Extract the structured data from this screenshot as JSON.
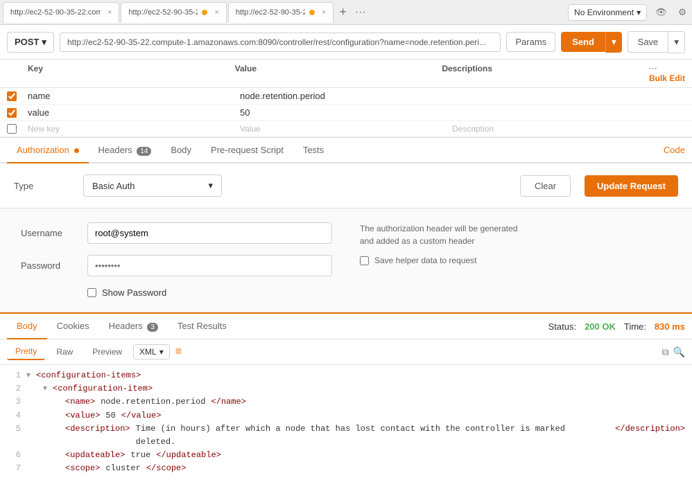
{
  "tabs": [
    {
      "label": "http://ec2-52-90-35-22.com",
      "active": false,
      "hasDot": false
    },
    {
      "label": "http://ec2-52-90-35-2:",
      "active": false,
      "hasDot": true
    },
    {
      "label": "http://ec2-52-90-35-2:",
      "active": true,
      "hasDot": true
    }
  ],
  "tab_add_label": "+",
  "tab_more_label": "···",
  "env": {
    "label": "No Environment",
    "eye_icon": "👁",
    "settings_icon": "⚙"
  },
  "url_bar": {
    "method": "POST",
    "url": "http://ec2-52-90-35-22.compute-1.amazonaws.com:8090/controller/rest/configuration?name=node.retention.peri...",
    "params_label": "Params",
    "send_label": "Send",
    "save_label": "Save"
  },
  "params_table": {
    "headers": {
      "key": "Key",
      "value": "Value",
      "description": "Descriptions",
      "bulk_edit": "Bulk Edit"
    },
    "rows": [
      {
        "checked": true,
        "key": "name",
        "value": "node.retention.period",
        "description": ""
      },
      {
        "checked": true,
        "key": "value",
        "value": "50",
        "description": ""
      }
    ],
    "new_key_placeholder": "New key",
    "value_placeholder": "Value",
    "description_placeholder": "Description"
  },
  "req_tabs": [
    {
      "label": "Authorization",
      "active": true,
      "dot": true,
      "badge": null
    },
    {
      "label": "Headers",
      "active": false,
      "dot": false,
      "badge": "14"
    },
    {
      "label": "Body",
      "active": false,
      "dot": false,
      "badge": null
    },
    {
      "label": "Pre-request Script",
      "active": false,
      "dot": false,
      "badge": null
    },
    {
      "label": "Tests",
      "active": false,
      "dot": false,
      "badge": null
    }
  ],
  "code_link": "Code",
  "auth": {
    "type_label": "Type",
    "type_value": "Basic Auth",
    "clear_label": "Clear",
    "update_label": "Update Request",
    "username_label": "Username",
    "username_value": "root@system",
    "password_label": "Password",
    "password_value": "••••••••",
    "show_password_label": "Show Password",
    "info_text": "The authorization header will be generated\nand added as a custom header",
    "save_helper_label": "Save helper data to request"
  },
  "resp_tabs": [
    {
      "label": "Body",
      "active": true
    },
    {
      "label": "Cookies",
      "active": false
    },
    {
      "label": "Headers",
      "active": false,
      "badge": "3"
    },
    {
      "label": "Test Results",
      "active": false
    }
  ],
  "status": {
    "label": "Status:",
    "code": "200 OK",
    "time_label": "Time:",
    "time_value": "830 ms"
  },
  "format_bar": {
    "tabs": [
      "Pretty",
      "Raw",
      "Preview"
    ],
    "active_tab": "Pretty",
    "format": "XML",
    "wrap_icon": "≡"
  },
  "xml_lines": [
    {
      "num": 1,
      "content": "<configuration-items>",
      "indent": 0,
      "collapse": true
    },
    {
      "num": 2,
      "content": "  <configuration-item>",
      "indent": 2,
      "collapse": true
    },
    {
      "num": 3,
      "content": "    <name>node.retention.period</name>",
      "indent": 4
    },
    {
      "num": 4,
      "content": "    <value>50</value>",
      "indent": 4
    },
    {
      "num": 5,
      "content": "    <description>Time (in hours) after which a node that has lost contact with the controller is marked deleted.</description>",
      "indent": 4
    },
    {
      "num": 6,
      "content": "    <updateable>true</updateable>",
      "indent": 4
    },
    {
      "num": 7,
      "content": "    <scope>cluster</scope>",
      "indent": 4
    }
  ]
}
